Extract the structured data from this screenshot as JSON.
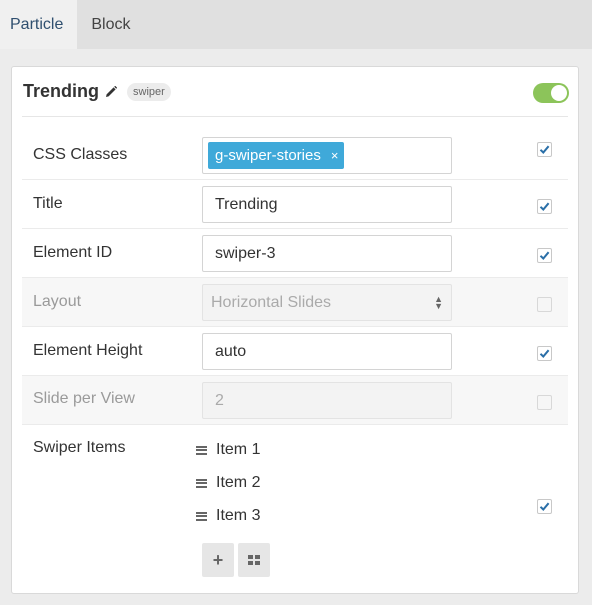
{
  "tabs": [
    {
      "label": "Particle",
      "active": true
    },
    {
      "label": "Block",
      "active": false
    }
  ],
  "card": {
    "title": "Trending",
    "badge": "swiper",
    "enabled": true
  },
  "fields": {
    "css_classes": {
      "label": "CSS Classes",
      "tags": [
        "g-swiper-stories"
      ],
      "remove_glyph": "×",
      "checked": true
    },
    "title": {
      "label": "Title",
      "value": "Trending",
      "checked": true
    },
    "element_id": {
      "label": "Element ID",
      "value": "swiper-3",
      "checked": true
    },
    "layout": {
      "label": "Layout",
      "value": "Horizontal Slides",
      "checked": false
    },
    "element_height": {
      "label": "Element Height",
      "value": "auto",
      "checked": true
    },
    "slide_per_view": {
      "label": "Slide per View",
      "value": "2",
      "checked": false
    },
    "swiper_items": {
      "label": "Swiper Items",
      "items": [
        "Item 1",
        "Item 2",
        "Item 3"
      ],
      "checked": true
    }
  },
  "buttons": {
    "add_glyph": "+",
    "grid_glyph": "grid-icon"
  },
  "colors": {
    "accent": "#3fa9d9",
    "toggle_on": "#8cc45a"
  }
}
